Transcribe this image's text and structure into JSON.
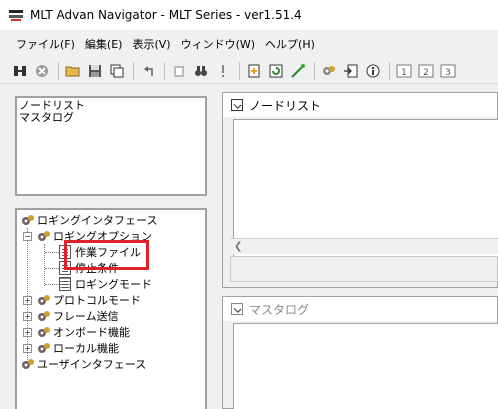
{
  "window": {
    "title": "MLT Advan Navigator - MLT Series - ver1.51.4"
  },
  "menu": [
    {
      "label": "ファイル(F)"
    },
    {
      "label": "編集(E)"
    },
    {
      "label": "表示(V)"
    },
    {
      "label": "ウィンドウ(W)"
    },
    {
      "label": "ヘルプ(H)"
    }
  ],
  "toolbar": {
    "buttons": [
      "connect-icon",
      "stop-icon",
      "open-folder-icon",
      "save-icon",
      "copy-window-icon",
      "undo-icon",
      "paste-icon",
      "binoculars-icon",
      "exclamation-icon",
      "new-doc-icon",
      "refresh-icon",
      "wand-icon",
      "gear-icon",
      "import-icon",
      "info-icon"
    ],
    "window_buttons": [
      "1",
      "2",
      "3"
    ]
  },
  "left": {
    "list_items": [
      "ノードリスト",
      "マスタログ"
    ],
    "tree": {
      "root": "ロギングインタフェース",
      "logging_option": "ロギングオプション",
      "children": [
        "作業ファイル",
        "停止条件",
        "ロギングモード"
      ],
      "protocol_mode": "プロトコルモード",
      "frame_send": "フレーム送信",
      "onboard": "オンボード機能",
      "local": "ローカル機能",
      "user_interface": "ユーザインタフェース"
    }
  },
  "windows": {
    "node_list": {
      "title": "ノードリスト"
    },
    "mastalog": {
      "title": "マスタログ"
    }
  },
  "colors": {
    "highlight": "#e0202a"
  }
}
